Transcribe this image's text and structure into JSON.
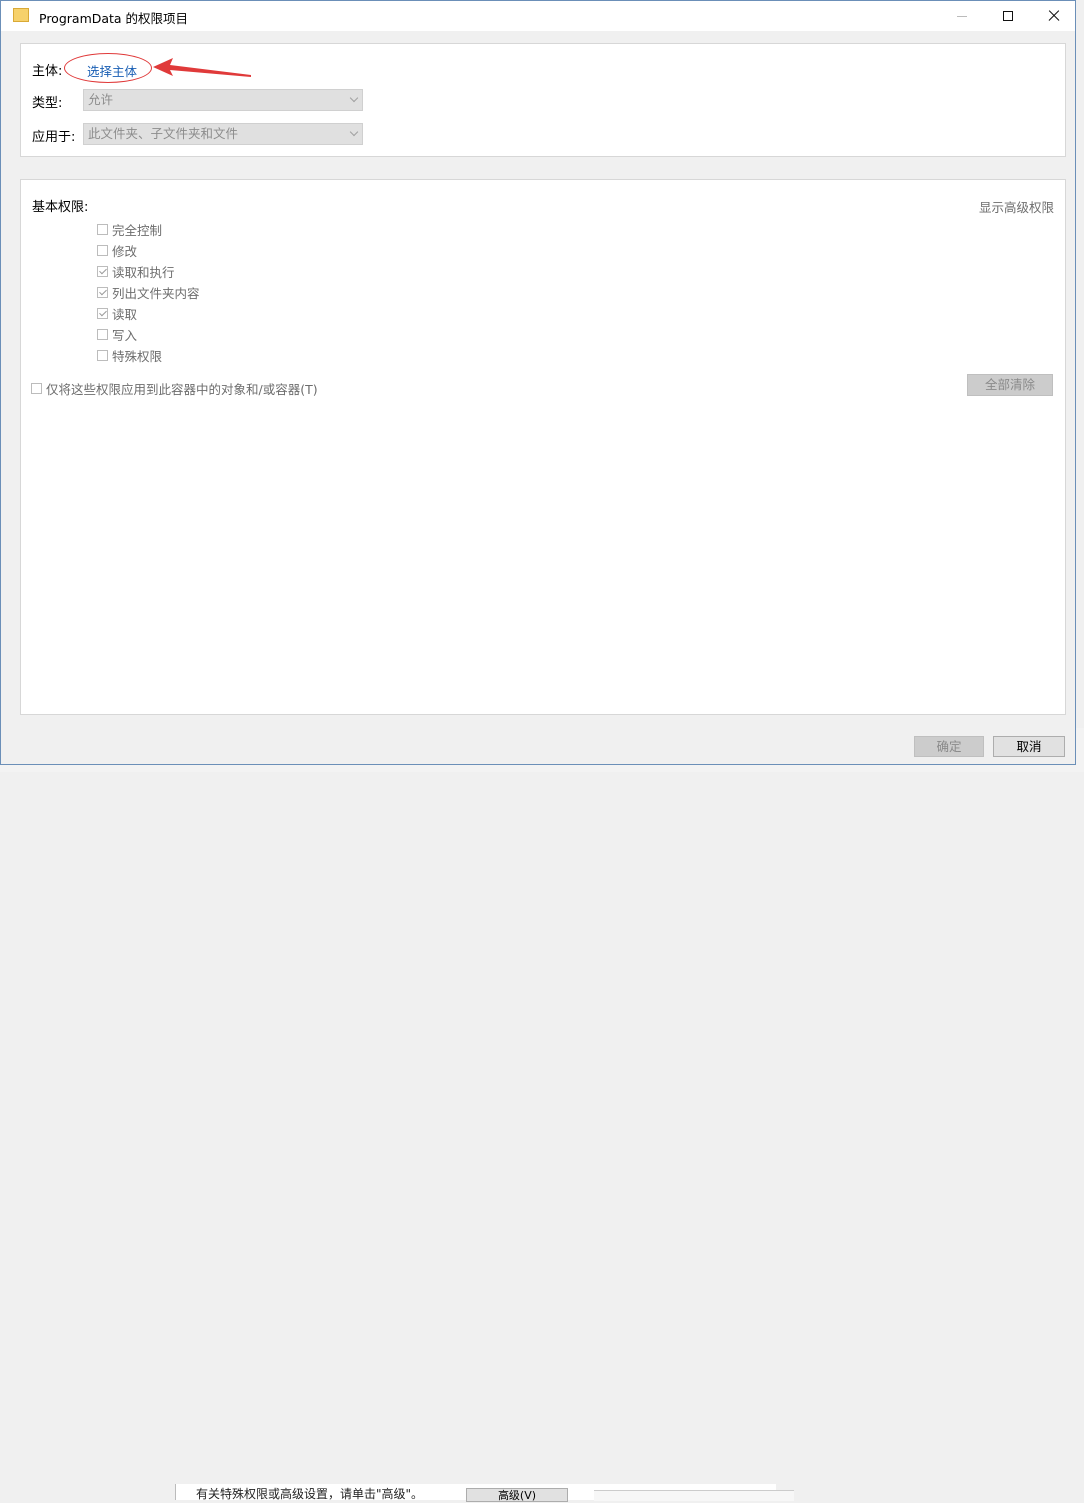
{
  "window": {
    "title": "ProgramData 的权限项目",
    "icons": {
      "folder": "folder-icon",
      "minimize": "minimize-icon",
      "maximize": "maximize-icon",
      "close": "close-icon"
    }
  },
  "principal": {
    "label": "主体:",
    "select_link": "选择主体"
  },
  "type": {
    "label": "类型:",
    "value": "允许"
  },
  "applies_to": {
    "label": "应用于:",
    "value": "此文件夹、子文件夹和文件"
  },
  "permissions": {
    "heading": "基本权限:",
    "show_advanced": "显示高级权限",
    "items": [
      {
        "label": "完全控制",
        "checked": false
      },
      {
        "label": "修改",
        "checked": false
      },
      {
        "label": "读取和执行",
        "checked": true
      },
      {
        "label": "列出文件夹内容",
        "checked": true
      },
      {
        "label": "读取",
        "checked": true
      },
      {
        "label": "写入",
        "checked": false
      },
      {
        "label": "特殊权限",
        "checked": false
      }
    ],
    "only_apply_label": "仅将这些权限应用到此容器中的对象和/或容器(T)",
    "clear_all": "全部清除"
  },
  "footer": {
    "ok": "确定",
    "cancel": "取消"
  },
  "behind_window": {
    "text": "有关特殊权限或高级设置，请单击\"高级\"。",
    "button": "高级(V)"
  },
  "colors": {
    "annotation": "#e03a3a",
    "link": "#1a5fb4"
  }
}
